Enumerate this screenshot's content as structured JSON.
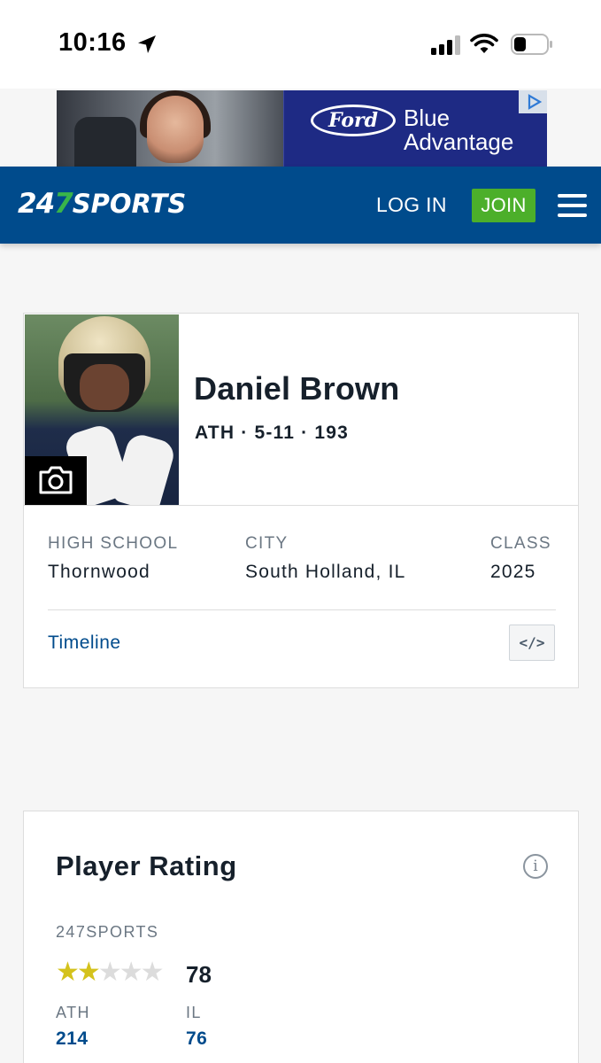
{
  "status_bar": {
    "time": "10:16"
  },
  "ad": {
    "brand": "Ford",
    "line1": "Blue",
    "line2": "Advantage"
  },
  "header": {
    "logo_num1": "24",
    "logo_num2": "7",
    "logo_text": "SPORTS",
    "login_label": "LOG IN",
    "join_label": "JOIN",
    "accent": "#004b8c",
    "join_color": "#4caf2a"
  },
  "player": {
    "name": "Daniel Brown",
    "position": "ATH",
    "height": "5-11",
    "weight": "193",
    "meta": "ATH · 5-11 · 193",
    "fields": {
      "high_school_label": "HIGH SCHOOL",
      "high_school": "Thornwood",
      "city_label": "CITY",
      "city": "South Holland, IL",
      "class_label": "CLASS",
      "class": "2025"
    },
    "timeline_label": "Timeline",
    "embed_label": "</>",
    "icons": {
      "photo": "camera-icon",
      "embed": "code-embed-icon"
    }
  },
  "rating": {
    "title": "Player Rating",
    "info_icon": "i",
    "source": "247SPORTS",
    "stars_filled": 2,
    "stars_total": 5,
    "score": "78",
    "ranks": [
      {
        "label": "ATH",
        "value": "214"
      },
      {
        "label": "IL",
        "value": "76"
      }
    ],
    "star_color": "#d4c21c"
  }
}
